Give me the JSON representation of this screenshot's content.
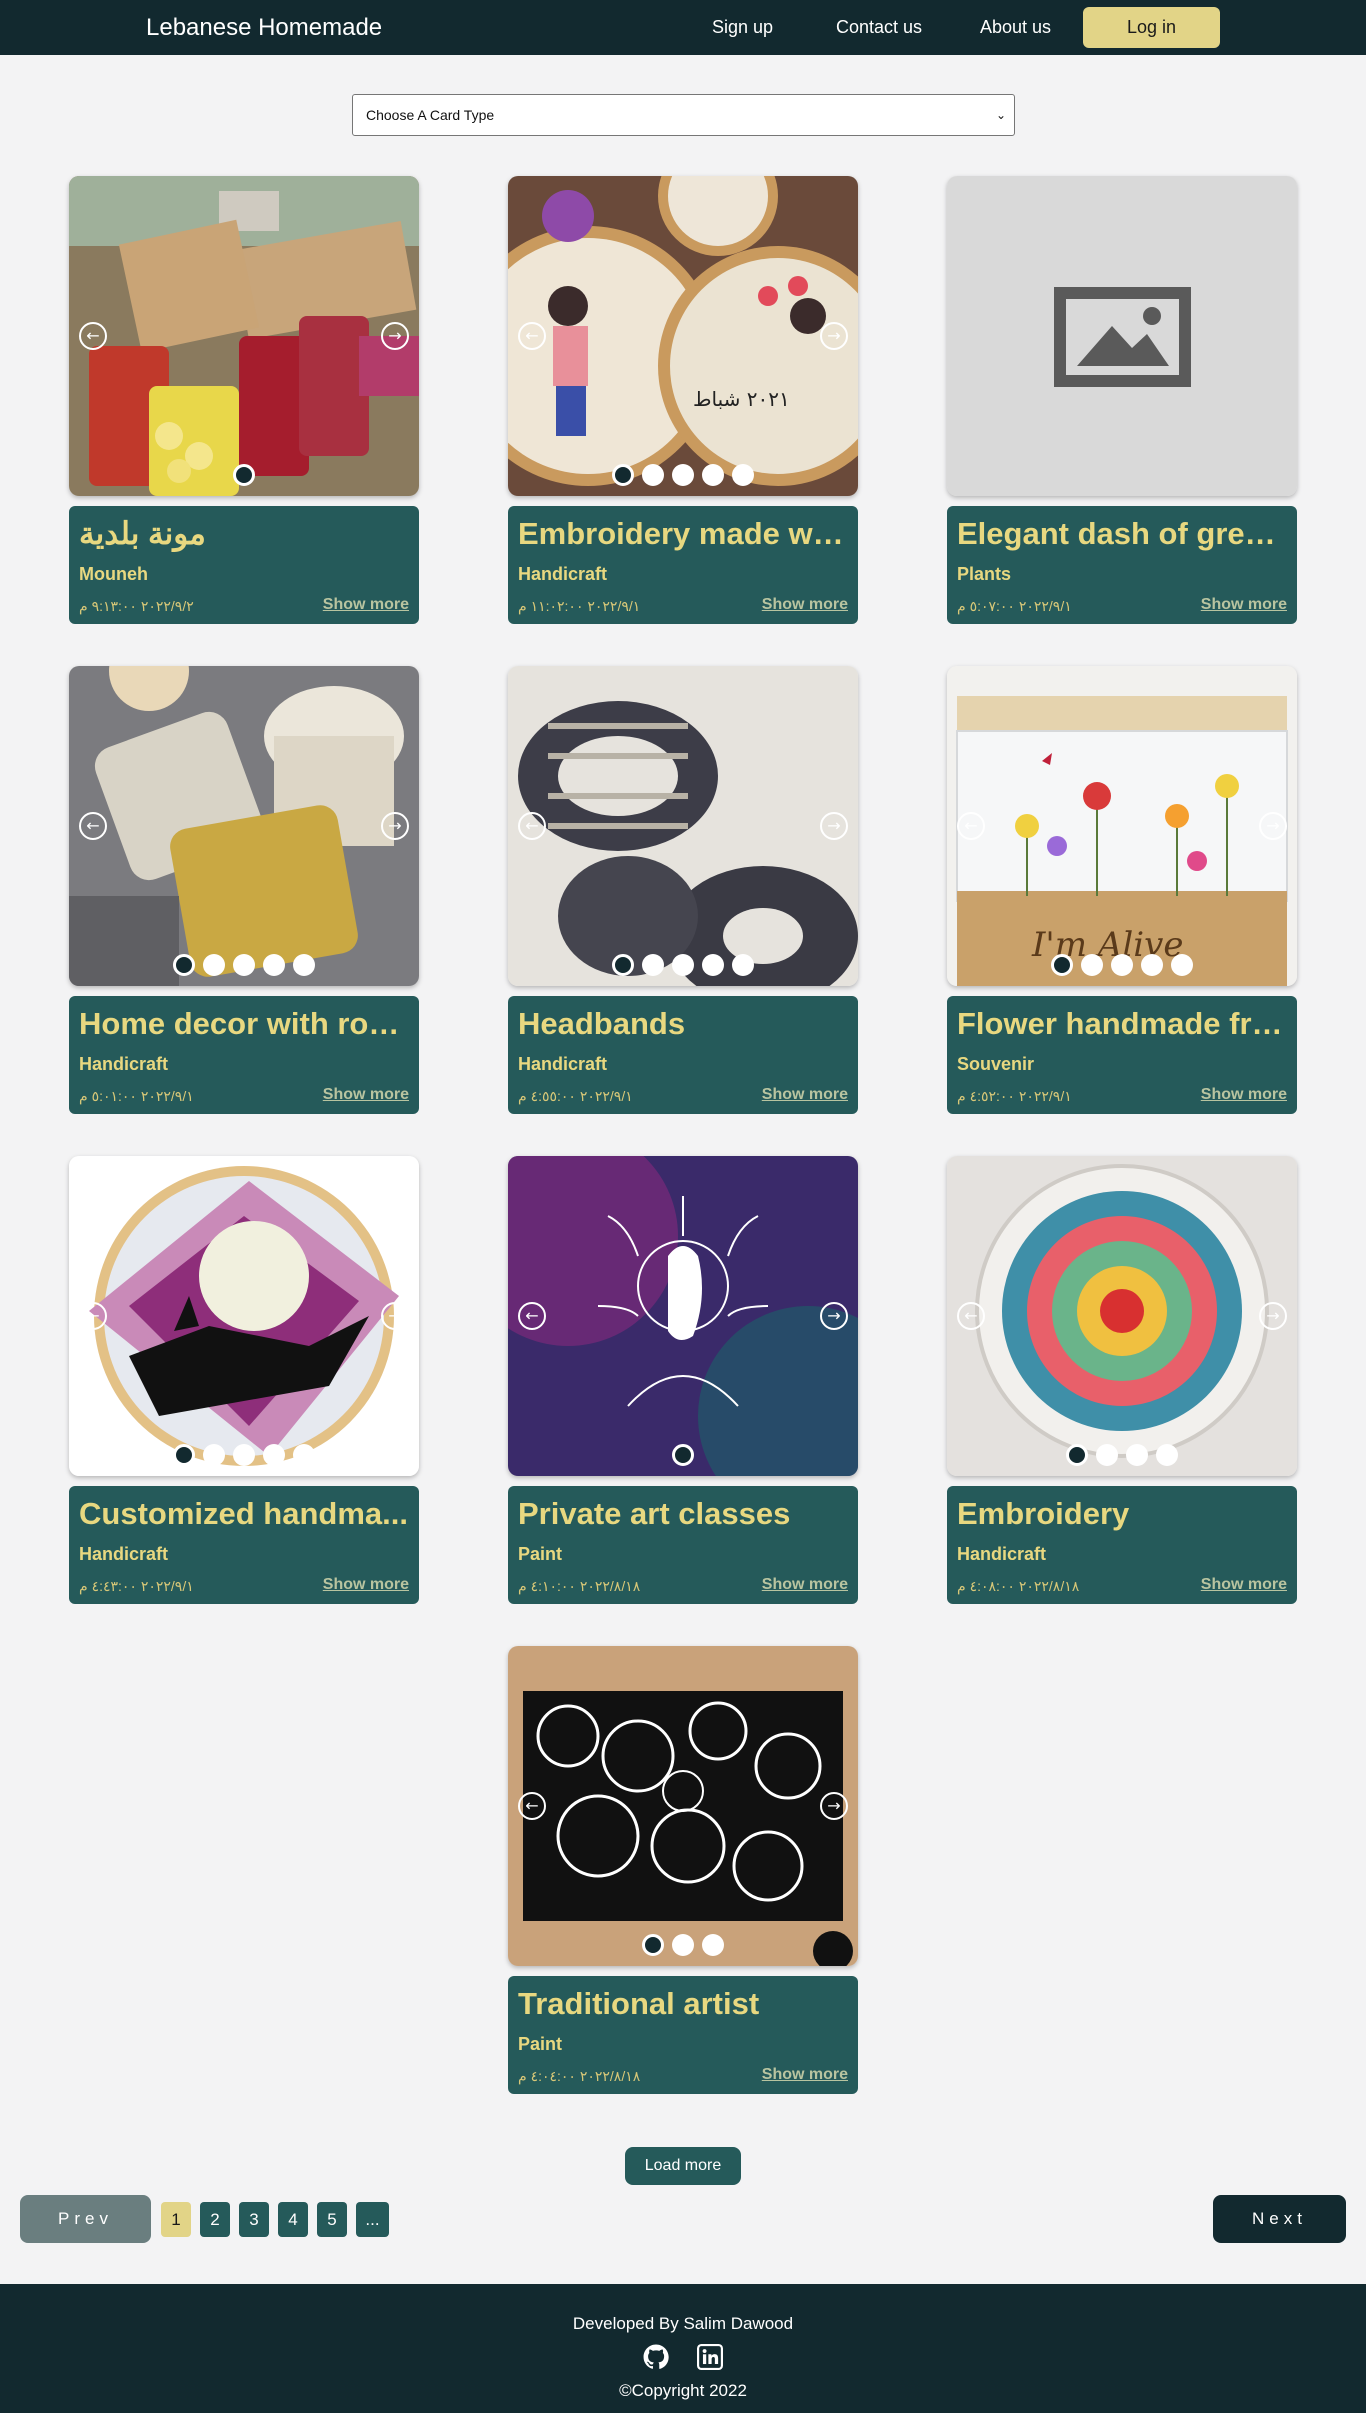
{
  "navbar": {
    "brand": "Lebanese Homemade",
    "links": [
      "Sign up",
      "Contact us",
      "About us"
    ],
    "login": "Log in"
  },
  "filter": {
    "selected": "Choose A Card Type"
  },
  "cards": [
    {
      "title": "مونة بلدية",
      "category": "Mouneh",
      "date": "٢٠٢٢/٩/٢ ٩:١٣:٠٠ م",
      "show_more": "Show more",
      "dots": 1,
      "image": "photo-jars"
    },
    {
      "title": "Embroidery made wit...",
      "category": "Handicraft",
      "date": "٢٠٢٢/٩/١ ١١:٠٢:٠٠ م",
      "show_more": "Show more",
      "dots": 5,
      "image": "photo-embroidery-hoops"
    },
    {
      "title": "Elegant dash of gree...",
      "category": "Plants",
      "date": "٢٠٢٢/٩/١ ٥:٠٧:٠٠ م",
      "show_more": "Show more",
      "dots": 0,
      "image": "image-placeholder"
    },
    {
      "title": "Home decor with rop...",
      "category": "Handicraft",
      "date": "٢٠٢٢/٩/١ ٥:٠١:٠٠ م",
      "show_more": "Show more",
      "dots": 5,
      "image": "photo-macrame"
    },
    {
      "title": "Headbands",
      "category": "Handicraft",
      "date": "٢٠٢٢/٩/١ ٤:٥٥:٠٠ م",
      "show_more": "Show more",
      "dots": 5,
      "image": "photo-headbands"
    },
    {
      "title": "Flower handmade fra...",
      "category": "Souvenir",
      "date": "٢٠٢٢/٩/١ ٤:٥٢:٠٠ م",
      "show_more": "Show more",
      "dots": 5,
      "image": "photo-flower-frame"
    },
    {
      "title": "Customized handma...",
      "category": "Handicraft",
      "date": "٢٠٢٢/٩/١ ٤:٤٣:٠٠ م",
      "show_more": "Show more",
      "dots": 5,
      "image": "photo-wolf-embroidery"
    },
    {
      "title": "Private art classes",
      "category": "Paint",
      "date": "٢٠٢٢/٨/١٨ ٤:١٠:٠٠ م",
      "show_more": "Show more",
      "dots": 1,
      "image": "photo-galaxy-art"
    },
    {
      "title": "Embroidery",
      "category": "Handicraft",
      "date": "٢٠٢٢/٨/١٨ ٤:٠٨:٠٠ م",
      "show_more": "Show more",
      "dots": 4,
      "image": "photo-mandala"
    },
    {
      "title": "Traditional artist",
      "category": "Paint",
      "date": "٢٠٢٢/٨/١٨ ٤:٠٤:٠٠ م",
      "show_more": "Show more",
      "dots": 3,
      "image": "photo-zentangle"
    }
  ],
  "pagination": {
    "load_more": "Load more",
    "prev": "Prev",
    "next": "Next",
    "pages": [
      "1",
      "2",
      "3",
      "4",
      "5",
      "..."
    ],
    "current": "1"
  },
  "footer": {
    "developer": "Developed By Salim Dawood",
    "icons": [
      "github-icon",
      "linkedin-icon"
    ],
    "copyright": "©Copyright 2022"
  },
  "colors": {
    "navbar": "#12292f",
    "accent": "#e2d487",
    "card_info": "#255a5a",
    "title_text": "#e8d880",
    "background": "#f3f3f4"
  }
}
